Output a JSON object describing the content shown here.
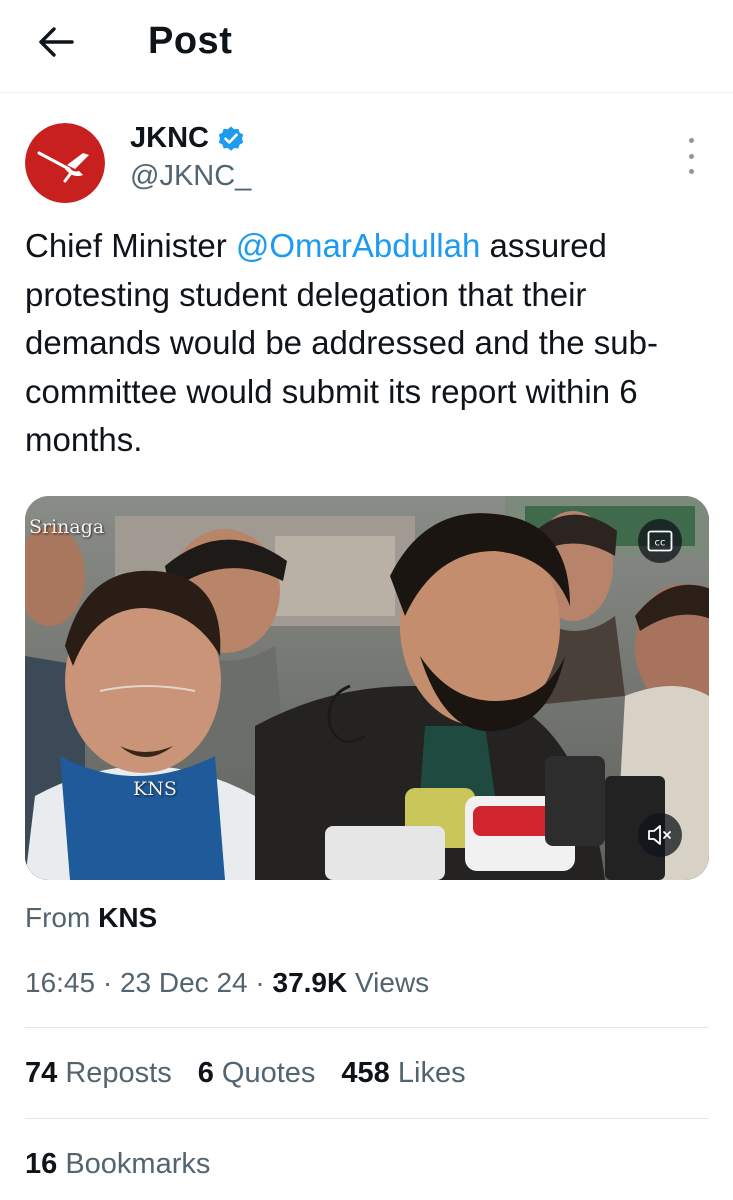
{
  "header": {
    "title": "Post"
  },
  "author": {
    "name": "JKNC",
    "handle": "@JKNC_"
  },
  "tweet": {
    "text_before": "Chief Minister ",
    "mention": "@OmarAbdullah",
    "text_after": " assured protesting student delegation that their demands would be addressed and the sub-committee would submit its report within 6 months."
  },
  "media": {
    "overlay_location": "Srinaga",
    "overlay_watermark": "KNS",
    "cc_label": "cc",
    "icons": {
      "captions": "cc-icon",
      "mute": "muted-speaker-icon"
    }
  },
  "source": {
    "prefix": "From",
    "name": "KNS"
  },
  "meta": {
    "time": "16:45",
    "sep1": " · ",
    "date": "23 Dec 24",
    "sep2": " · ",
    "views_count": "37.9K",
    "views_label": "Views"
  },
  "stats": {
    "reposts": {
      "count": "74",
      "label": "Reposts"
    },
    "quotes": {
      "count": "6",
      "label": "Quotes"
    },
    "likes": {
      "count": "458",
      "label": "Likes"
    },
    "bookmarks": {
      "count": "16",
      "label": "Bookmarks"
    }
  },
  "colors": {
    "accent": "#1d9bf0",
    "avatar_bg": "#c8201f",
    "text_secondary": "#536471"
  }
}
